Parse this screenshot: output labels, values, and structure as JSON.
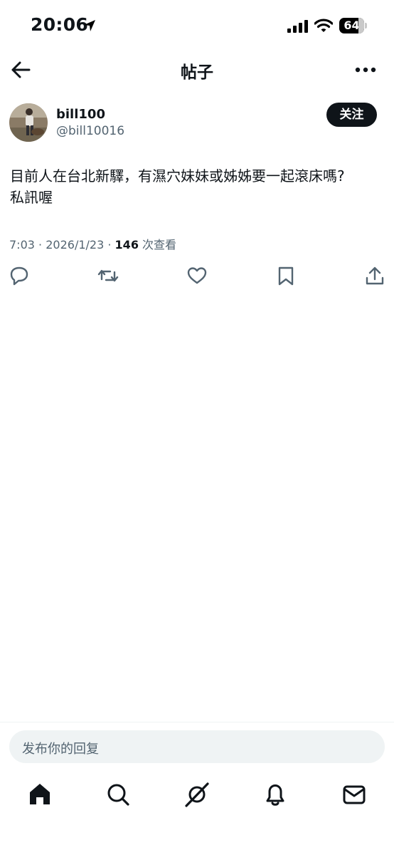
{
  "status_bar": {
    "time": "20:06",
    "battery": "64"
  },
  "nav": {
    "title": "帖子"
  },
  "post": {
    "author_name": "bill100",
    "author_handle": "@bill10016",
    "follow_label": "关注",
    "text_line1": "目前人在台北新驛，有濕穴妹妹或姊姊要一起滾床嗎?",
    "text_line2": "私訊喔",
    "time": "7:03",
    "date": "2026/1/23",
    "views_count": "146",
    "views_label": "次查看",
    "separator": "·"
  },
  "reply": {
    "placeholder": "发布你的回复"
  },
  "icons": {
    "back": "back-arrow-icon",
    "more": "more-dots-icon",
    "reply": "reply-bubble-icon",
    "retweet": "retweet-icon",
    "like": "heart-icon",
    "bookmark": "bookmark-icon",
    "share": "share-icon",
    "home": "home-icon",
    "search": "search-icon",
    "grok": "grok-icon",
    "notifications": "bell-icon",
    "messages": "mail-icon"
  },
  "colors": {
    "text": "#0f1419",
    "secondary": "#536471",
    "input_bg": "#eff3f4"
  }
}
